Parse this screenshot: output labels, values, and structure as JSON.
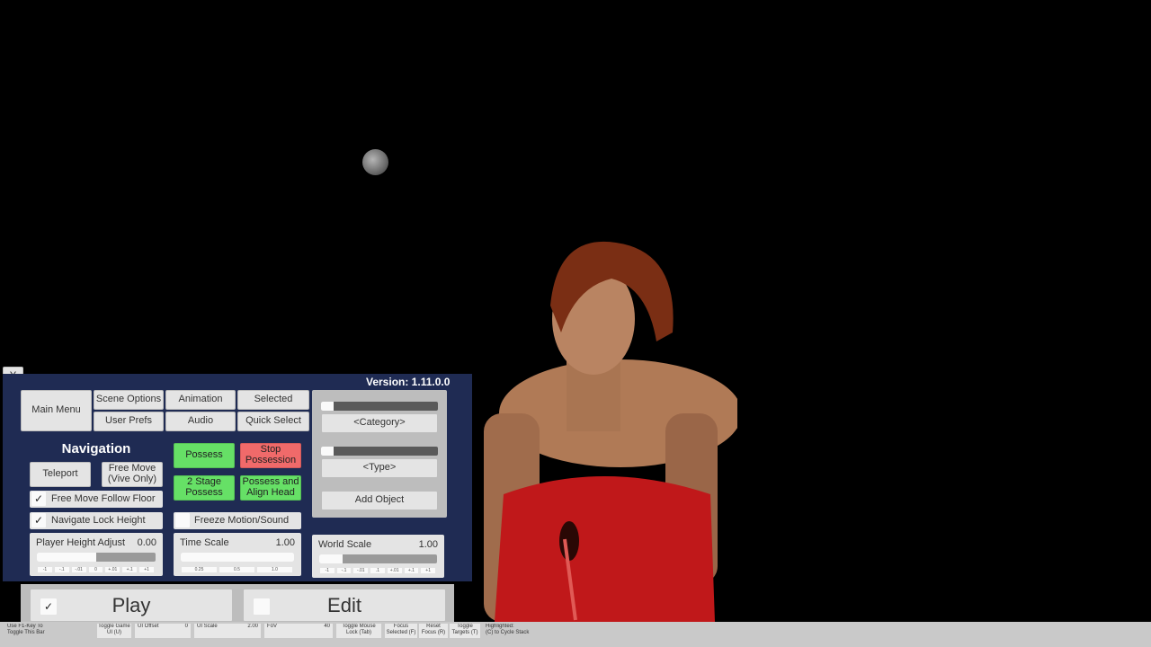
{
  "close_label": "X",
  "version": "Version: 1.11.0.0",
  "tabs": {
    "main_menu": "Main Menu",
    "scene_options": "Scene Options",
    "animation": "Animation",
    "selected": "Selected",
    "user_prefs": "User Prefs",
    "audio": "Audio",
    "quick_select": "Quick Select"
  },
  "navigation": {
    "heading": "Navigation",
    "teleport": "Teleport",
    "free_move": "Free Move\n(Vive Only)",
    "follow_floor": "Free Move Follow Floor",
    "lock_height": "Navigate Lock Height"
  },
  "possess": {
    "possess": "Possess",
    "stop": "Stop\nPossession",
    "two_stage": "2 Stage\nPossess",
    "align_head": "Possess and\nAlign Head",
    "freeze": "Freeze Motion/Sound"
  },
  "player_height": {
    "label": "Player Height Adjust",
    "value": "0.00",
    "level": 0.5,
    "steps": [
      "-1",
      "-.1",
      "-.01",
      "0",
      "+.01",
      "+.1",
      "+1"
    ]
  },
  "time_scale": {
    "label": "Time Scale",
    "value": "1.00",
    "level": 1.0,
    "steps": [
      "0.25",
      "0.5",
      "1.0"
    ]
  },
  "world_scale": {
    "label": "World Scale",
    "value": "1.00",
    "level": 0.2,
    "steps": [
      "-1",
      "-.1",
      "-.01",
      ".1",
      "+.01",
      "+.1",
      "+1"
    ]
  },
  "add_object": {
    "category": "<Category>",
    "type": "<Type>",
    "button": "Add Object"
  },
  "mode": {
    "play": "Play",
    "edit": "Edit",
    "play_checked": true
  },
  "bottom_bar": {
    "uid_hint": "Use F1-Key To\nToggle This Bar",
    "toggle_game_ui": "Toggle Game\nUI (U)",
    "ui_offset_label": "UI Offset",
    "ui_offset_value": "0",
    "ui_scale_label": "UI Scale",
    "ui_scale_value": "2.00",
    "fov_label": "FoV",
    "fov_value": "40",
    "toggle_mouse_lock": "Toggle Mouse\nLock (Tab)",
    "focus_selected": "Focus\nSelected (F)",
    "reset_focus": "Reset\nFocus (R)",
    "toggle_targets": "Toggle\nTargets (T)",
    "highlighted": "Highlighted:\n(C) to Cycle Stack"
  },
  "colors": {
    "panel": "#1f2b53",
    "green": "#66e066",
    "red": "#f06a6a",
    "dress": "#c0181a"
  }
}
